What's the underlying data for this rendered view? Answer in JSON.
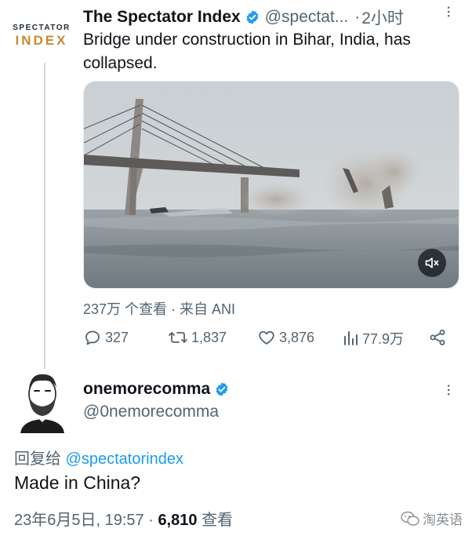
{
  "tweet": {
    "author_name": "The Spectator Index",
    "author_handle": "@spectat...",
    "separator": "·",
    "time": "2小时",
    "avatar_line1": "SPECTATOR",
    "avatar_line2": "INDEX",
    "text": "Bridge under construction in Bihar, India, has collapsed.",
    "views_source": "237万 个查看 · 来自 ANI",
    "actions": {
      "replies": "327",
      "retweets": "1,837",
      "likes": "3,876",
      "views": "77.9万"
    }
  },
  "reply": {
    "author_name": "onemorecomma",
    "author_handle": "@0nemorecomma",
    "reply_to_prefix": "回复给 ",
    "reply_to_mention": "@spectatorindex",
    "text": "Made in China?",
    "date_time": "23年6月5日, 19:57 · ",
    "view_count": "6,810",
    "view_label": " 查看"
  },
  "watermark": "淘英语",
  "colors": {
    "accent": "#1d9bf0",
    "text": "#0f1419",
    "secondary": "#536471"
  }
}
